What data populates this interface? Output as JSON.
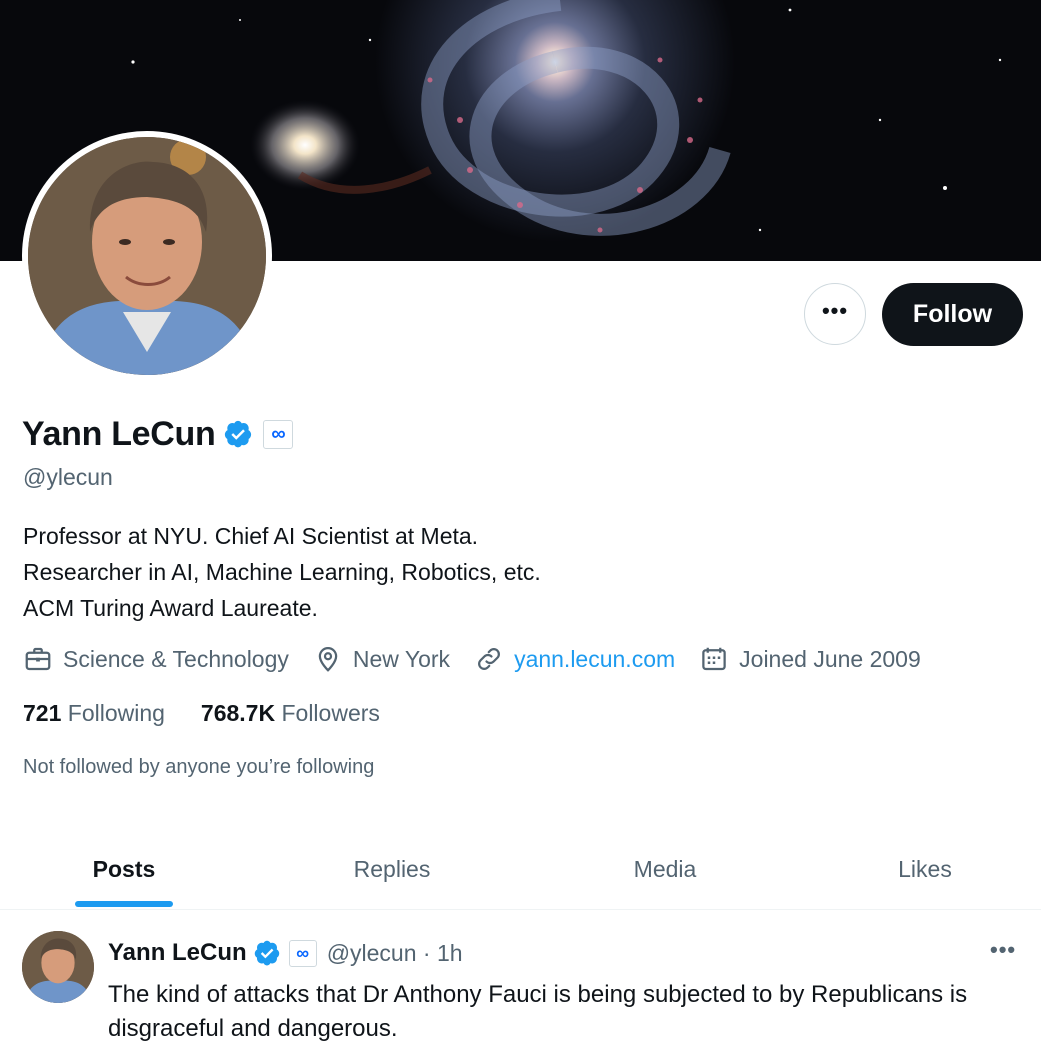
{
  "profile": {
    "name": "Yann LeCun",
    "handle": "@ylecun",
    "meta_badge": "∞",
    "bio_lines": [
      "Professor at NYU. Chief AI Scientist at Meta.",
      "Researcher in AI, Machine Learning, Robotics, etc.",
      "ACM Turing Award Laureate."
    ],
    "category": "Science & Technology",
    "location": "New York",
    "website": "yann.lecun.com",
    "joined": "Joined June 2009",
    "following_count": "721",
    "following_label": "Following",
    "followers_count": "768.7K",
    "followers_label": "Followers",
    "not_followed_text": "Not followed by anyone you’re following"
  },
  "actions": {
    "more_label": "•••",
    "follow_label": "Follow"
  },
  "tabs": [
    {
      "label": "Posts",
      "active": true
    },
    {
      "label": "Replies",
      "active": false
    },
    {
      "label": "Media",
      "active": false
    },
    {
      "label": "Likes",
      "active": false
    }
  ],
  "tweet": {
    "author_name": "Yann LeCun",
    "handle_time": "@ylecun · 1h",
    "more_label": "•••",
    "text": "The kind of attacks that Dr Anthony Fauci is being subjected to by Republicans is disgraceful and dangerous."
  },
  "colors": {
    "accent": "#1d9bf0",
    "text_primary": "#0f1419",
    "text_secondary": "#536471",
    "follow_bg": "#0f1419",
    "meta_blue": "#0866ff"
  },
  "icons": {
    "verified": "verified-badge-icon",
    "category": "briefcase-icon",
    "location": "location-pin-icon",
    "website": "link-icon",
    "joined": "calendar-icon"
  }
}
